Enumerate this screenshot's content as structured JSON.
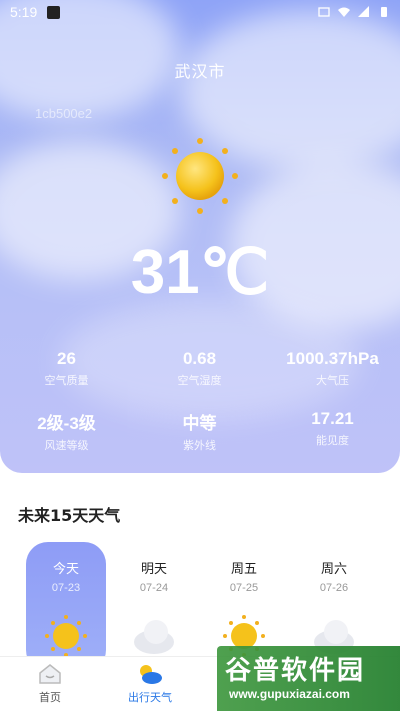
{
  "status_bar": {
    "time": "5:19"
  },
  "weather": {
    "city": "武汉市",
    "code": "1cb500e2",
    "temperature": "31℃",
    "condition_icon": "sun-icon",
    "stats": [
      {
        "value": "26",
        "label": "空气质量"
      },
      {
        "value": "0.68",
        "label": "空气湿度"
      },
      {
        "value": "1000.37hPa",
        "label": "大气压"
      },
      {
        "value": "2级-3级",
        "label": "风速等级"
      },
      {
        "value": "中等",
        "label": "紫外线"
      },
      {
        "value": "17.21",
        "label": "能见度"
      }
    ]
  },
  "forecast": {
    "title": "未来15天天气",
    "days": [
      {
        "name": "今天",
        "date": "07-23",
        "icon": "sun-icon",
        "active": true
      },
      {
        "name": "明天",
        "date": "07-24",
        "icon": "cloud-icon",
        "active": false
      },
      {
        "name": "周五",
        "date": "07-25",
        "icon": "sun-icon",
        "active": false
      },
      {
        "name": "周六",
        "date": "07-26",
        "icon": "cloud-icon",
        "active": false
      }
    ]
  },
  "tabbar": {
    "tabs": [
      {
        "label": "首页",
        "icon": "home-icon",
        "active": false
      },
      {
        "label": "出行天气",
        "icon": "weather-icon",
        "active": true
      }
    ]
  },
  "watermark": {
    "title": "谷普软件园",
    "url": "www.gupuxiazai.com"
  },
  "colors": {
    "accent": "#2a78e6",
    "hero_top": "#8fa4f7",
    "hero_bottom": "#bfc2f8",
    "sun": "#f5c21b"
  }
}
